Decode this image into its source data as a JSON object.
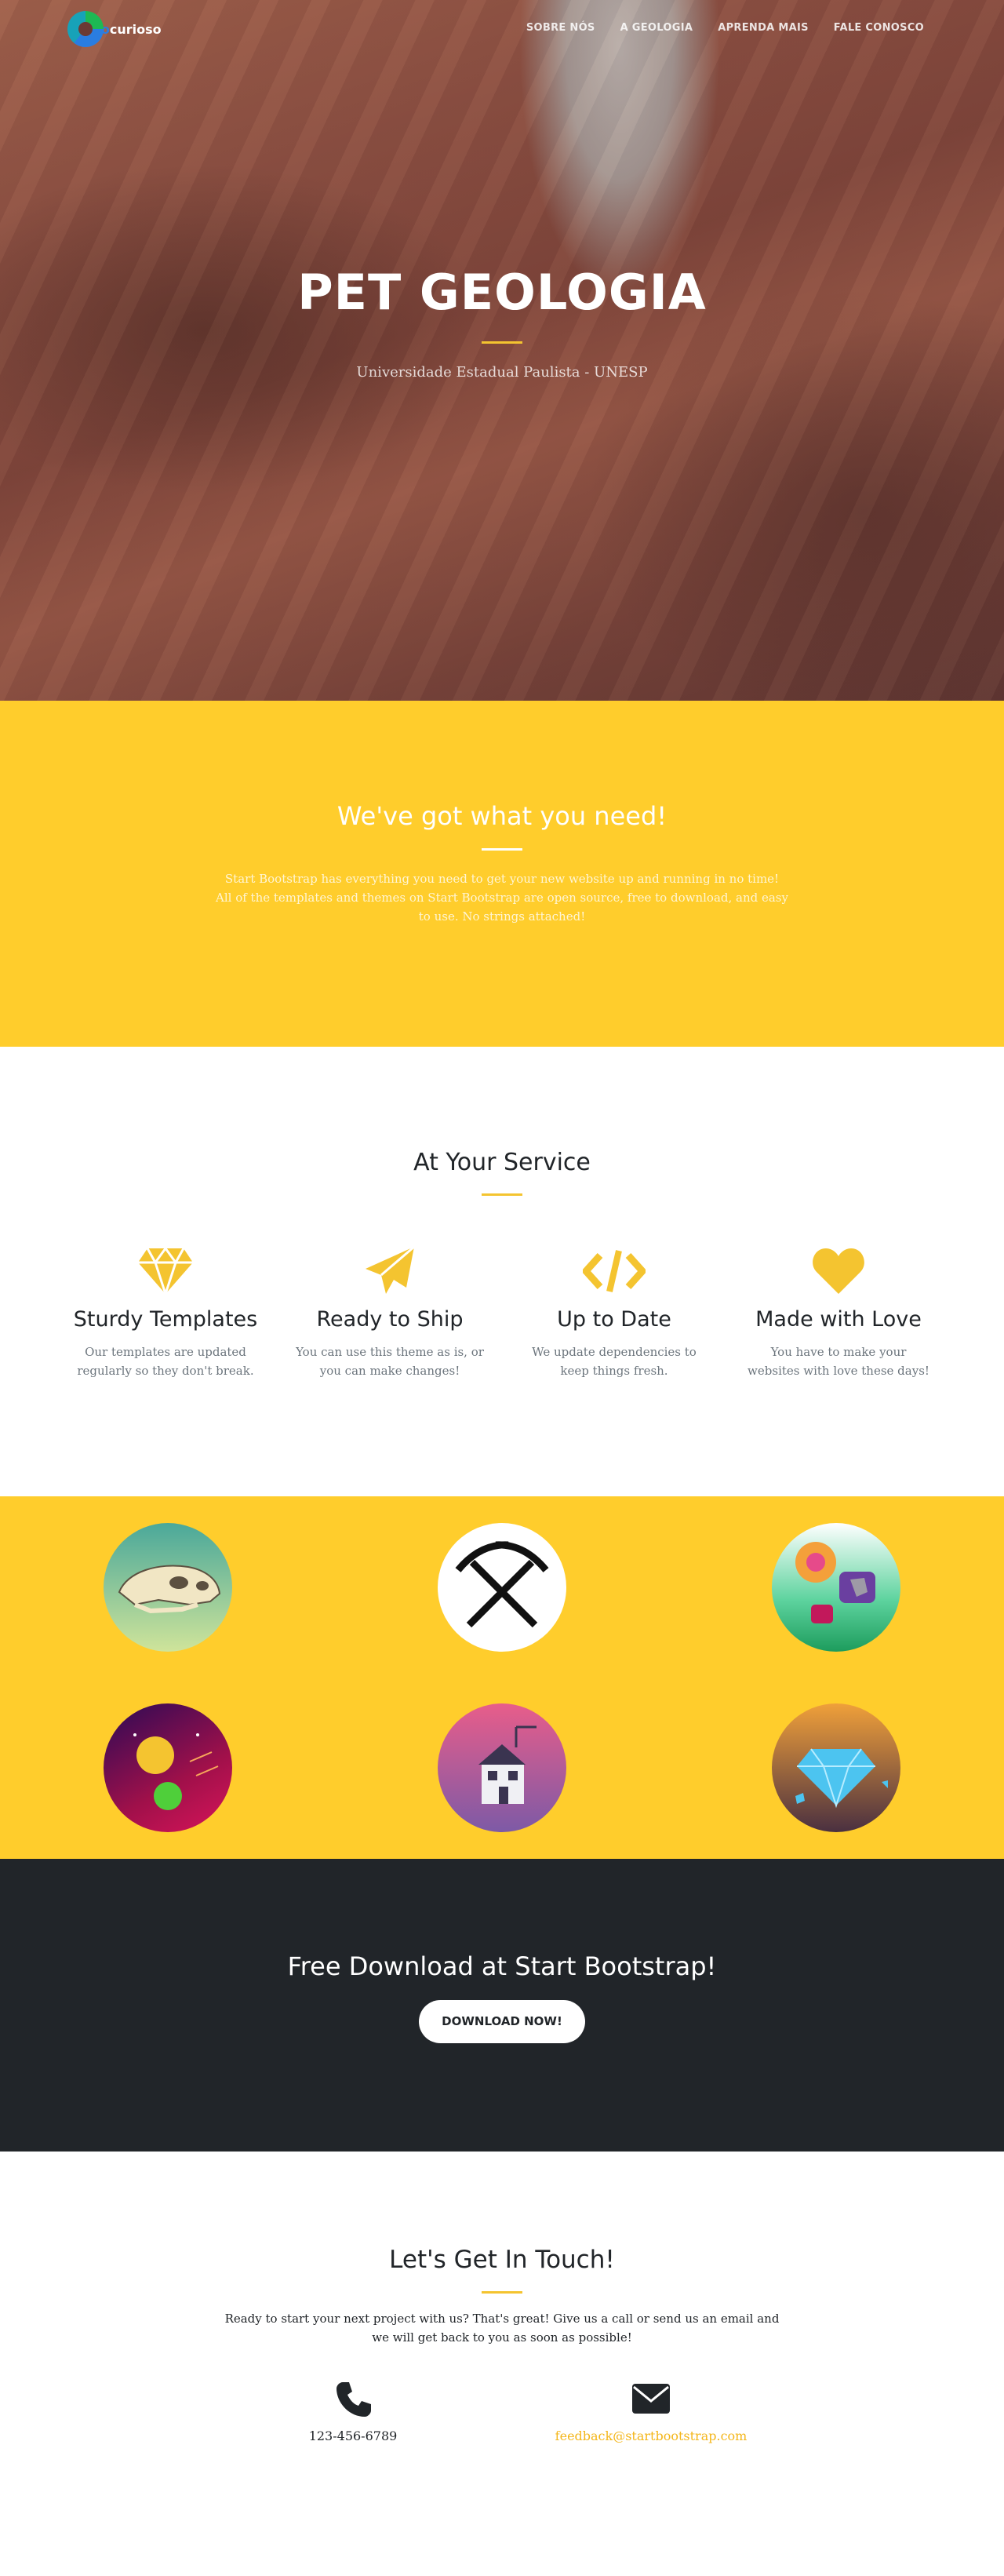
{
  "nav": {
    "brand_prefix": "G",
    "brand_mid": "eo",
    "brand_suffix": "curioso",
    "items": [
      "SOBRE NÓS",
      "A GEOLOGIA",
      "APRENDA MAIS",
      "FALE CONOSCO"
    ]
  },
  "hero": {
    "title": "PET GEOLOGIA",
    "subtitle": "Universidade Estadual Paulista - UNESP"
  },
  "intro": {
    "title": "We've got what you need!",
    "text": "Start Bootstrap has everything you need to get your new website up and running in no time! All of the templates and themes on Start Bootstrap are open source, free to download, and easy to use. No strings attached!"
  },
  "services": {
    "title": "At Your Service",
    "items": [
      {
        "title": "Sturdy Templates",
        "text": "Our templates are updated regularly so they don't break.",
        "icon": "diamond-icon"
      },
      {
        "title": "Ready to Ship",
        "text": "You can use this theme as is, or you can make changes!",
        "icon": "paper-plane-icon"
      },
      {
        "title": "Up to Date",
        "text": "We update dependencies to keep things fresh.",
        "icon": "code-icon"
      },
      {
        "title": "Made with Love",
        "text": "You have to make your websites with love these days!",
        "icon": "heart-icon"
      }
    ]
  },
  "portfolio": {
    "items": [
      "dinosaur-skull-icon",
      "pickaxes-icon",
      "minerals-chat-icon",
      "planets-icon",
      "house-icon",
      "gem-icon"
    ]
  },
  "download": {
    "title": "Free Download at Start Bootstrap!",
    "button": "DOWNLOAD NOW!"
  },
  "contact": {
    "title": "Let's Get In Touch!",
    "text": "Ready to start your next project with us? That's great! Give us a call or send us an email and we will get back to you as soon as possible!",
    "phone": "123-456-6789",
    "email": "feedback@startbootstrap.com"
  },
  "colors": {
    "accent": "#ffcd2c",
    "dark": "#212529",
    "link": "#f4b619"
  }
}
